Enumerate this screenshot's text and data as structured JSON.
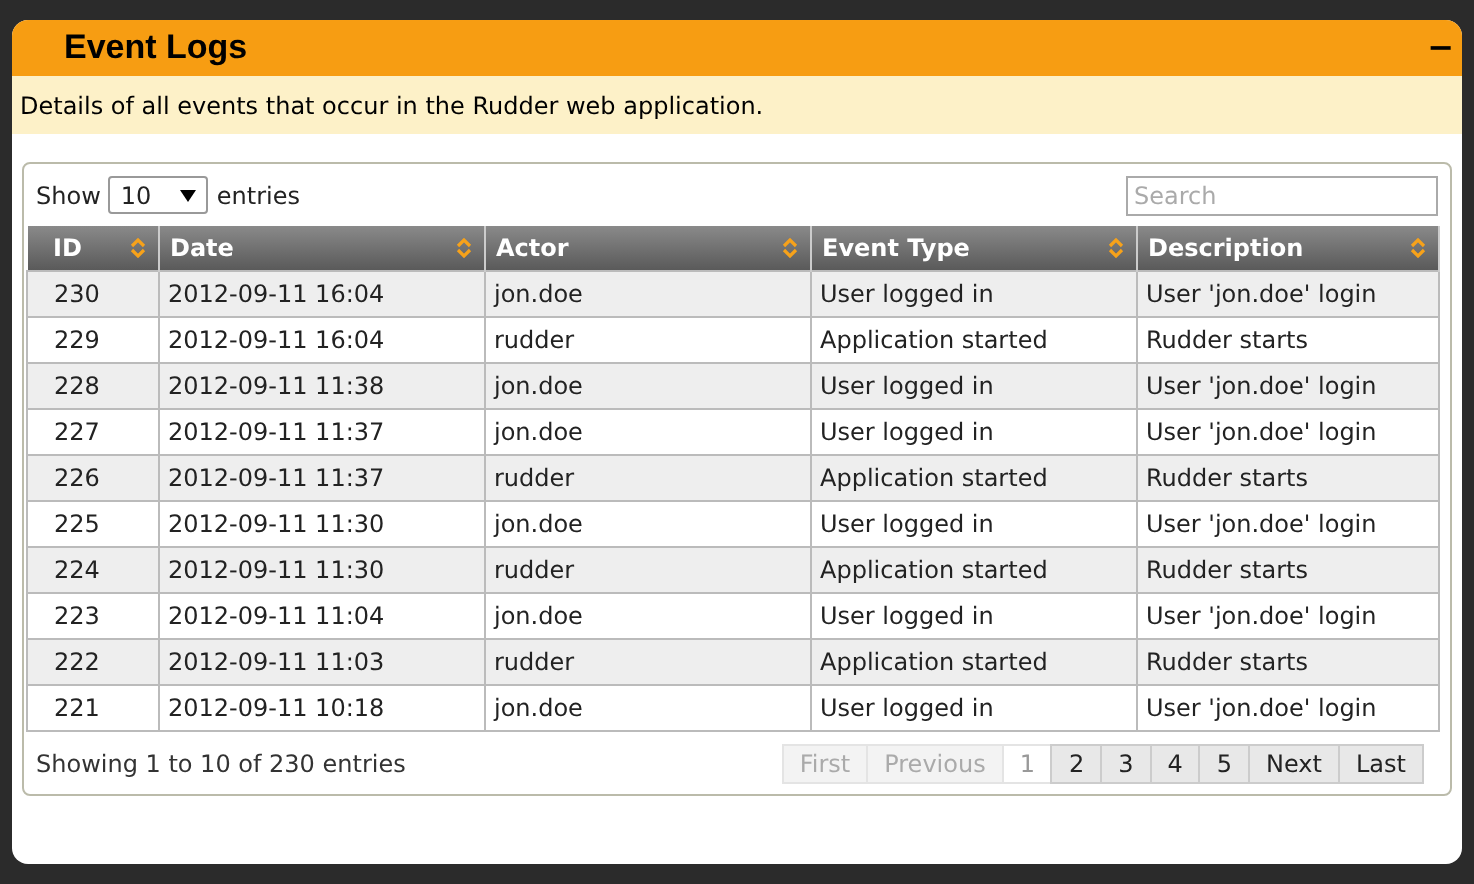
{
  "panel": {
    "title": "Event Logs",
    "collapse_symbol": "−",
    "description": "Details of all events that occur in the Rudder web application."
  },
  "length_control": {
    "before": "Show",
    "value": "10",
    "after": "entries"
  },
  "search": {
    "placeholder": "Search"
  },
  "table": {
    "columns": [
      "ID",
      "Date",
      "Actor",
      "Event Type",
      "Description"
    ],
    "rows": [
      [
        "230",
        "2012-09-11 16:04",
        "jon.doe",
        "User logged in",
        "User 'jon.doe' login"
      ],
      [
        "229",
        "2012-09-11 16:04",
        "rudder",
        "Application started",
        "Rudder starts"
      ],
      [
        "228",
        "2012-09-11 11:38",
        "jon.doe",
        "User logged in",
        "User 'jon.doe' login"
      ],
      [
        "227",
        "2012-09-11 11:37",
        "jon.doe",
        "User logged in",
        "User 'jon.doe' login"
      ],
      [
        "226",
        "2012-09-11 11:37",
        "rudder",
        "Application started",
        "Rudder starts"
      ],
      [
        "225",
        "2012-09-11 11:30",
        "jon.doe",
        "User logged in",
        "User 'jon.doe' login"
      ],
      [
        "224",
        "2012-09-11 11:30",
        "rudder",
        "Application started",
        "Rudder starts"
      ],
      [
        "223",
        "2012-09-11 11:04",
        "jon.doe",
        "User logged in",
        "User 'jon.doe' login"
      ],
      [
        "222",
        "2012-09-11 11:03",
        "rudder",
        "Application started",
        "Rudder starts"
      ],
      [
        "221",
        "2012-09-11 10:18",
        "jon.doe",
        "User logged in",
        "User 'jon.doe' login"
      ]
    ]
  },
  "info": "Showing 1 to 10 of 230 entries",
  "pagination": [
    {
      "label": "First",
      "disabled": true,
      "selected": false
    },
    {
      "label": "Previous",
      "disabled": true,
      "selected": false
    },
    {
      "label": "1",
      "disabled": false,
      "selected": true
    },
    {
      "label": "2",
      "disabled": false,
      "selected": false
    },
    {
      "label": "3",
      "disabled": false,
      "selected": false
    },
    {
      "label": "4",
      "disabled": false,
      "selected": false
    },
    {
      "label": "5",
      "disabled": false,
      "selected": false
    },
    {
      "label": "Next",
      "disabled": false,
      "selected": false
    },
    {
      "label": "Last",
      "disabled": false,
      "selected": false
    }
  ]
}
